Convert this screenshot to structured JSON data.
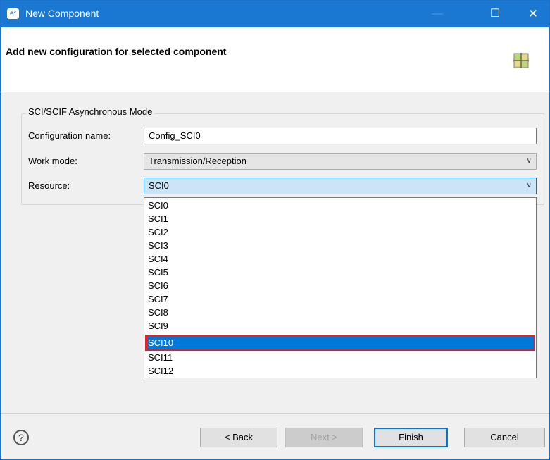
{
  "window": {
    "title": "New Component",
    "app_icon": "e²"
  },
  "header": {
    "title": "Add new configuration for selected component"
  },
  "group": {
    "legend": "SCI/SCIF Asynchronous Mode",
    "config_name_label": "Configuration name:",
    "config_name_value": "Config_SCI0",
    "work_mode_label": "Work mode:",
    "work_mode_value": "Transmission/Reception",
    "resource_label": "Resource:",
    "resource_value": "SCI0"
  },
  "dropdown": {
    "options": [
      "SCI0",
      "SCI1",
      "SCI2",
      "SCI3",
      "SCI4",
      "SCI5",
      "SCI6",
      "SCI7",
      "SCI8",
      "SCI9",
      "SCI10",
      "SCI11",
      "SCI12"
    ],
    "highlighted": "SCI10"
  },
  "buttons": {
    "help": "?",
    "back": "< Back",
    "next": "Next >",
    "finish": "Finish",
    "cancel": "Cancel"
  },
  "colors": {
    "titlebar": "#1a77d2",
    "selection": "#0078d7",
    "highlight_outline": "#e0202a"
  }
}
